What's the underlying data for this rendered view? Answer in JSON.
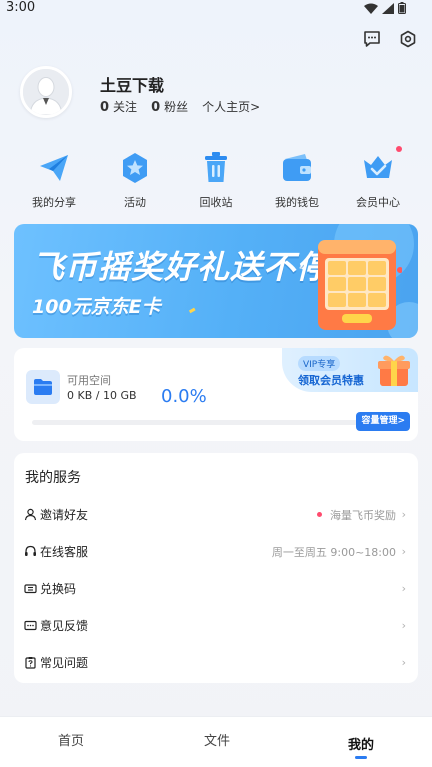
{
  "status_bar": {
    "time": "3:00"
  },
  "header": {
    "message_icon": "message-icon",
    "settings_icon": "settings-icon"
  },
  "profile": {
    "username": "土豆下载",
    "following_count": "0",
    "following_label": "关注",
    "followers_count": "0",
    "followers_label": "粉丝",
    "homepage_link": "个人主页>"
  },
  "quick_actions": [
    {
      "label": "我的分享",
      "icon": "paper-plane-icon"
    },
    {
      "label": "活动",
      "icon": "star-badge-icon"
    },
    {
      "label": "回收站",
      "icon": "trash-icon"
    },
    {
      "label": "我的钱包",
      "icon": "wallet-icon"
    },
    {
      "label": "会员中心",
      "icon": "crown-icon"
    }
  ],
  "banner": {
    "title": "飞币摇奖好礼送不停",
    "subtitle": "100元京东E卡"
  },
  "storage": {
    "vip_chip": "VIP专享",
    "vip_text": "领取会员特惠",
    "space_label": "可用空间",
    "space_value": "0 KB / 10 GB",
    "percent_text": "0.0%",
    "percent_value": 0.0,
    "manage_button": "容量管理>"
  },
  "services": {
    "title": "我的服务",
    "items": [
      {
        "label": "邀请好友",
        "extra": "海量飞币奖励",
        "icon": "user-invite-icon",
        "has_dot": true
      },
      {
        "label": "在线客服",
        "extra": "周一至周五 9:00~18:00",
        "icon": "headset-icon",
        "has_dot": false
      },
      {
        "label": "兑换码",
        "extra": "",
        "icon": "ticket-icon",
        "has_dot": false
      },
      {
        "label": "意见反馈",
        "extra": "",
        "icon": "feedback-icon",
        "has_dot": false
      },
      {
        "label": "常见问题",
        "extra": "",
        "icon": "faq-icon",
        "has_dot": false
      }
    ]
  },
  "tabbar": {
    "tabs": [
      {
        "label": "首页"
      },
      {
        "label": "文件"
      },
      {
        "label": "我的",
        "active": true
      }
    ]
  },
  "colors": {
    "accent": "#2b7cf1",
    "dot_red": "#ff4b6e"
  }
}
